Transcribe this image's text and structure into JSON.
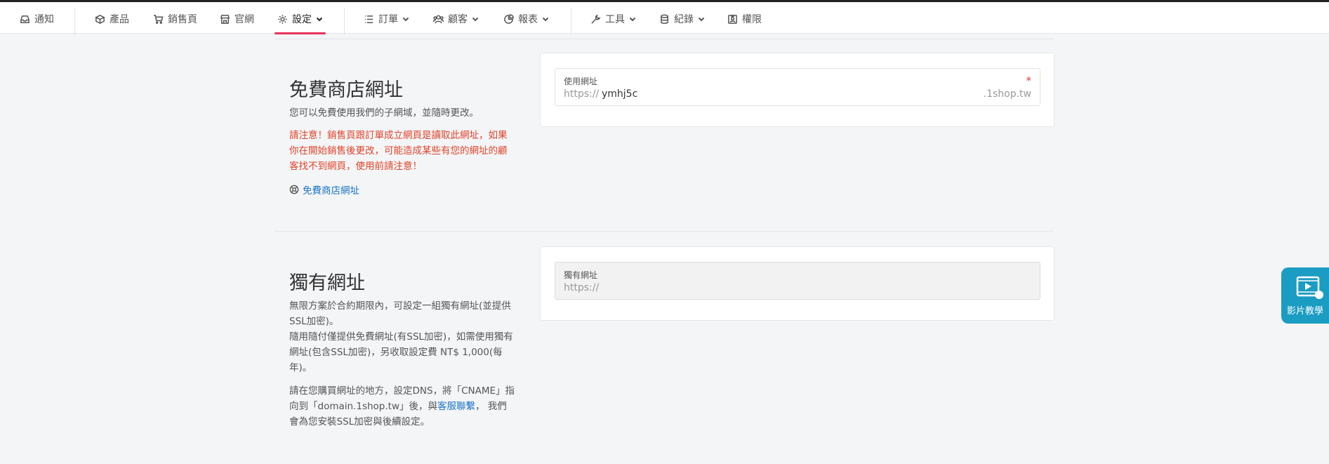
{
  "nav": {
    "notice": "通知",
    "products": "產品",
    "sales_page": "銷售頁",
    "website": "官網",
    "settings": "設定",
    "orders": "訂單",
    "customers": "顧客",
    "reports": "報表",
    "tools": "工具",
    "logs": "紀錄",
    "permissions": "權限"
  },
  "free_domain": {
    "title": "免費商店網址",
    "desc": "您可以免費使用我們的子網域，並隨時更改。",
    "warning": "請注意！銷售頁跟訂單成立網頁是讀取此網址，如果你在開始銷售後更改，可能造成某些有您的網址的顧客找不到網頁，使用前請注意！",
    "link_label": "免費商店網址",
    "field_label": "使用網址",
    "required_mark": "*",
    "prefix": "https://",
    "value": "ymhj5c",
    "suffix": ".1shop.tw"
  },
  "custom_domain": {
    "title": "獨有網址",
    "desc1": "無限方案於合約期限內，可設定一組獨有網址(並提供SSL加密)。",
    "desc2": "隨用隨付僅提供免費網址(有SSL加密)，如需使用獨有網址(包含SSL加密)，另收取設定費 NT$ 1,000(每年)。",
    "desc3_pre": "請在您購買網址的地方，設定DNS，將「CNAME」指向到「domain.1shop.tw」後，與",
    "desc3_link": "客服聯繫",
    "desc3_post": "， 我們會為您安裝SSL加密與後續設定。",
    "field_label": "獨有網址",
    "prefix": "https://"
  },
  "video_tutorial": "影片教學",
  "colors": {
    "accent": "#e8335a",
    "warning": "#e0442a",
    "link": "#1a73c9",
    "video_button": "#1b9cc2"
  }
}
